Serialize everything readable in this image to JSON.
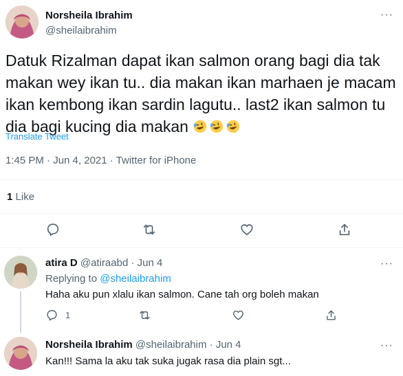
{
  "main_tweet": {
    "author_name": "Norsheila Ibrahim",
    "author_handle": "@sheilaibrahim",
    "more_label": "···",
    "text": "Datuk Rizalman dapat ikan salmon orang bagi dia tak makan wey ikan tu.. dia makan ikan marhaen je macam ikan kembong ikan sardin lagutu.. last2 ikan salmon tu dia bagi kucing dia makan",
    "emoji": [
      "rofl-emoji",
      "rofl-emoji",
      "rofl-emoji"
    ],
    "translate_label": "Translate Tweet",
    "timestamp": "1:45 PM · Jun 4, 2021 · Twitter for iPhone",
    "like_count": "1",
    "like_label": "Like",
    "actions": [
      "reply-icon",
      "retweet-icon",
      "like-icon",
      "share-icon"
    ]
  },
  "replies": [
    {
      "author_name": "atira D",
      "author_handle": "@atiraabd",
      "date": "· Jun 4",
      "replying_prefix": "Replying to",
      "replying_to": "@sheilaibrahim",
      "text": "Haha aku pun xlalu ikan salmon. Cane tah org boleh makan",
      "reply_count": "1",
      "more_label": "···"
    },
    {
      "author_name": "Norsheila Ibrahim",
      "author_handle": "@sheilaibrahim",
      "date": "· Jun 4",
      "text": "Kan!!! Sama la aku tak suka jugak rasa dia plain sgt...",
      "more_label": "···"
    }
  ],
  "colors": {
    "accent": "#1d9bf0",
    "text": "#0f1419",
    "secondary": "#536471",
    "divider": "#eff3f4"
  }
}
